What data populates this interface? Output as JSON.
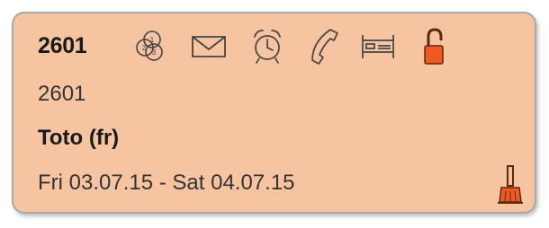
{
  "card": {
    "room_number": "2601",
    "room_code": "2601",
    "guest_name": "Toto (fr)",
    "date_range": "Fri 03.07.15 - Sat 04.07.15",
    "background_color": "#f7c4a2",
    "accent_color": "#f05a22"
  },
  "icons": [
    "coins-icon",
    "mail-icon",
    "alarm-clock-icon",
    "phone-icon",
    "bed-icon",
    "padlock-icon"
  ],
  "status_icon": "cleaning-brush-icon"
}
